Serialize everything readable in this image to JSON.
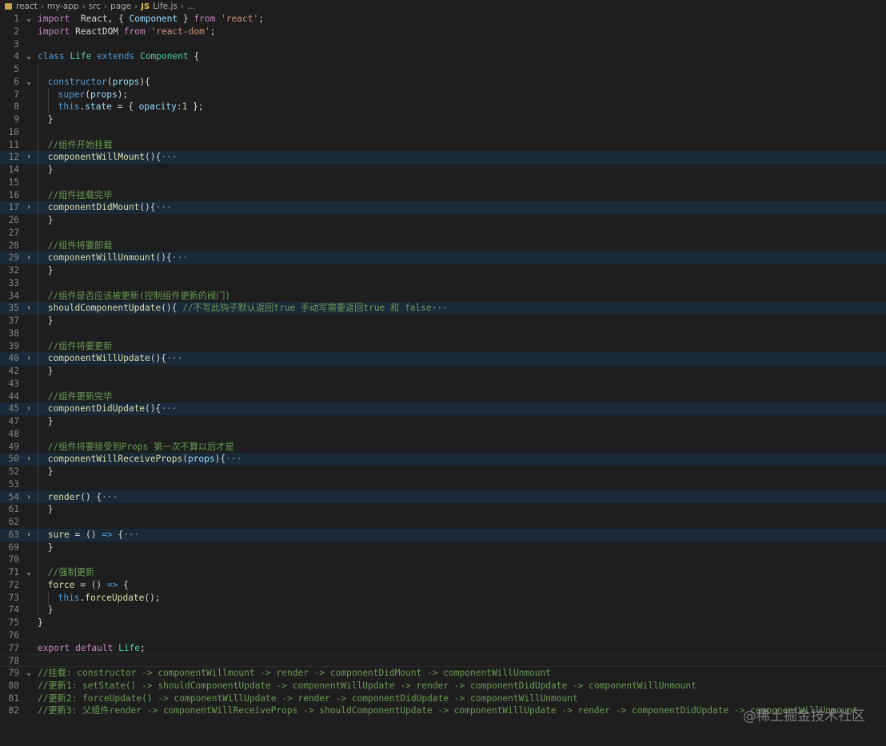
{
  "breadcrumb": {
    "items": [
      "react",
      "my-app",
      "src",
      "page"
    ],
    "file_badge": "JS",
    "file": "Life.js",
    "trailing": "..."
  },
  "watermark": "@稀土掘金技术社区",
  "colors": {
    "background": "#1e1e1e",
    "folded_line_bg": "#1b2a38",
    "keyword": "#569cd6",
    "control": "#c586c0",
    "class": "#4ec9b0",
    "function": "#dcdcaa",
    "string": "#ce9178",
    "variable": "#9cdcfe",
    "number": "#b5cea8",
    "comment": "#6a9955"
  },
  "lines": [
    {
      "n": "1",
      "fold": "v",
      "indent": 0,
      "tokens": [
        [
          "ctl",
          "import"
        ],
        [
          "",
          "  React, { "
        ],
        [
          "var",
          "Component"
        ],
        [
          "",
          " } "
        ],
        [
          "ctl",
          "from"
        ],
        [
          "",
          " "
        ],
        [
          "str",
          "'react'"
        ],
        [
          "",
          ";"
        ]
      ]
    },
    {
      "n": "2",
      "indent": 0,
      "tokens": [
        [
          "ctl",
          "import"
        ],
        [
          "",
          " ReactDOM "
        ],
        [
          "ctl",
          "from"
        ],
        [
          "",
          " "
        ],
        [
          "str",
          "'react-dom'"
        ],
        [
          "",
          ";"
        ]
      ]
    },
    {
      "n": "3",
      "indent": 0,
      "tokens": []
    },
    {
      "n": "4",
      "fold": "v",
      "indent": 0,
      "tokens": [
        [
          "kw",
          "class"
        ],
        [
          "",
          " "
        ],
        [
          "cls",
          "Life"
        ],
        [
          "",
          " "
        ],
        [
          "kw",
          "extends"
        ],
        [
          "",
          " "
        ],
        [
          "cls",
          "Component"
        ],
        [
          "",
          " {"
        ]
      ]
    },
    {
      "n": "5",
      "indent": 1,
      "tokens": []
    },
    {
      "n": "6",
      "fold": "v",
      "indent": 1,
      "tokens": [
        [
          "kw",
          "constructor"
        ],
        [
          "",
          "("
        ],
        [
          "var",
          "props"
        ],
        [
          "",
          "){"
        ]
      ]
    },
    {
      "n": "7",
      "indent": 2,
      "tokens": [
        [
          "kw",
          "super"
        ],
        [
          "",
          "("
        ],
        [
          "var",
          "props"
        ],
        [
          "",
          ");"
        ]
      ]
    },
    {
      "n": "8",
      "indent": 2,
      "tokens": [
        [
          "kw",
          "this"
        ],
        [
          "",
          "."
        ],
        [
          "var",
          "state"
        ],
        [
          "",
          " = { "
        ],
        [
          "var",
          "opacity"
        ],
        [
          "",
          ":"
        ],
        [
          "num",
          "1"
        ],
        [
          "",
          " };"
        ]
      ]
    },
    {
      "n": "9",
      "indent": 1,
      "tokens": [
        [
          "",
          "}"
        ]
      ]
    },
    {
      "n": "10",
      "indent": 1,
      "tokens": []
    },
    {
      "n": "11",
      "indent": 1,
      "tokens": [
        [
          "cmt",
          "//组件开始挂载"
        ]
      ]
    },
    {
      "n": "12",
      "fold": ">",
      "folded": true,
      "indent": 1,
      "tokens": [
        [
          "fn",
          "componentWillMount"
        ],
        [
          "",
          "(){"
        ],
        [
          "ell",
          "···"
        ]
      ]
    },
    {
      "n": "14",
      "indent": 1,
      "tokens": [
        [
          "",
          "}"
        ]
      ]
    },
    {
      "n": "15",
      "indent": 1,
      "tokens": []
    },
    {
      "n": "16",
      "indent": 1,
      "tokens": [
        [
          "cmt",
          "//组件挂载完毕"
        ]
      ]
    },
    {
      "n": "17",
      "fold": ">",
      "folded": true,
      "indent": 1,
      "tokens": [
        [
          "fn",
          "componentDidMount"
        ],
        [
          "",
          "(){"
        ],
        [
          "ell",
          "···"
        ]
      ]
    },
    {
      "n": "26",
      "indent": 1,
      "tokens": [
        [
          "",
          "}"
        ]
      ]
    },
    {
      "n": "27",
      "indent": 1,
      "tokens": []
    },
    {
      "n": "28",
      "indent": 1,
      "tokens": [
        [
          "cmt",
          "//组件将要卸载"
        ]
      ]
    },
    {
      "n": "29",
      "fold": ">",
      "folded": true,
      "indent": 1,
      "tokens": [
        [
          "fn",
          "componentWillUnmount"
        ],
        [
          "",
          "(){"
        ],
        [
          "ell",
          "···"
        ]
      ]
    },
    {
      "n": "32",
      "indent": 1,
      "tokens": [
        [
          "",
          "}"
        ]
      ]
    },
    {
      "n": "33",
      "indent": 1,
      "tokens": []
    },
    {
      "n": "34",
      "indent": 1,
      "tokens": [
        [
          "cmt",
          "//组件是否应该被更新(控制组件更新的阀门)"
        ]
      ]
    },
    {
      "n": "35",
      "fold": ">",
      "folded": true,
      "indent": 1,
      "tokens": [
        [
          "fn",
          "shouldComponentUpdate"
        ],
        [
          "",
          "(){ "
        ],
        [
          "cmt",
          "//不写此钩子默认返回true 手动写需要返回true 和 false"
        ],
        [
          "ell",
          "···"
        ]
      ]
    },
    {
      "n": "37",
      "indent": 1,
      "tokens": [
        [
          "",
          "}"
        ]
      ]
    },
    {
      "n": "38",
      "indent": 1,
      "tokens": []
    },
    {
      "n": "39",
      "indent": 1,
      "tokens": [
        [
          "cmt",
          "//组件将要更新"
        ]
      ]
    },
    {
      "n": "40",
      "fold": ">",
      "folded": true,
      "indent": 1,
      "tokens": [
        [
          "fn",
          "componentWillUpdate"
        ],
        [
          "",
          "(){"
        ],
        [
          "ell",
          "···"
        ]
      ]
    },
    {
      "n": "42",
      "indent": 1,
      "tokens": [
        [
          "",
          "}"
        ]
      ]
    },
    {
      "n": "43",
      "indent": 1,
      "tokens": []
    },
    {
      "n": "44",
      "indent": 1,
      "tokens": [
        [
          "cmt",
          "//组件更新完毕"
        ]
      ]
    },
    {
      "n": "45",
      "fold": ">",
      "folded": true,
      "indent": 1,
      "tokens": [
        [
          "fn",
          "componentDidUpdate"
        ],
        [
          "",
          "(){"
        ],
        [
          "ell",
          "···"
        ]
      ]
    },
    {
      "n": "47",
      "indent": 1,
      "tokens": [
        [
          "",
          "}"
        ]
      ]
    },
    {
      "n": "48",
      "indent": 1,
      "tokens": []
    },
    {
      "n": "49",
      "indent": 1,
      "tokens": [
        [
          "cmt",
          "//组件将要接受到Props 第一次不算以后才是"
        ]
      ]
    },
    {
      "n": "50",
      "fold": ">",
      "folded": true,
      "indent": 1,
      "tokens": [
        [
          "fn",
          "componentWillReceiveProps"
        ],
        [
          "",
          "("
        ],
        [
          "var",
          "props"
        ],
        [
          "",
          "){"
        ],
        [
          "ell",
          "···"
        ]
      ]
    },
    {
      "n": "52",
      "indent": 1,
      "tokens": [
        [
          "",
          "}"
        ]
      ]
    },
    {
      "n": "53",
      "indent": 1,
      "tokens": []
    },
    {
      "n": "54",
      "fold": ">",
      "folded": true,
      "indent": 1,
      "tokens": [
        [
          "fn",
          "render"
        ],
        [
          "",
          "() {"
        ],
        [
          "ell",
          "···"
        ]
      ]
    },
    {
      "n": "61",
      "indent": 1,
      "tokens": [
        [
          "",
          "}"
        ]
      ]
    },
    {
      "n": "62",
      "indent": 1,
      "tokens": []
    },
    {
      "n": "63",
      "fold": ">",
      "folded": true,
      "indent": 1,
      "tokens": [
        [
          "fn",
          "sure"
        ],
        [
          "",
          " = () "
        ],
        [
          "kw",
          "=>"
        ],
        [
          "",
          " {"
        ],
        [
          "ell",
          "···"
        ]
      ]
    },
    {
      "n": "69",
      "indent": 1,
      "tokens": [
        [
          "",
          "}"
        ]
      ]
    },
    {
      "n": "70",
      "indent": 1,
      "tokens": []
    },
    {
      "n": "71",
      "fold": "v",
      "indent": 1,
      "tokens": [
        [
          "cmt",
          "//强制更新"
        ]
      ]
    },
    {
      "n": "72",
      "indent": 1,
      "tokens": [
        [
          "fn",
          "force"
        ],
        [
          "",
          " = () "
        ],
        [
          "kw",
          "=>"
        ],
        [
          "",
          " {"
        ]
      ]
    },
    {
      "n": "73",
      "indent": 2,
      "tokens": [
        [
          "kw",
          "this"
        ],
        [
          "",
          "."
        ],
        [
          "fn",
          "forceUpdate"
        ],
        [
          "",
          "();"
        ]
      ]
    },
    {
      "n": "74",
      "indent": 1,
      "tokens": [
        [
          "",
          "}"
        ]
      ]
    },
    {
      "n": "75",
      "indent": 0,
      "tokens": [
        [
          "",
          "}"
        ]
      ]
    },
    {
      "n": "76",
      "indent": 0,
      "tokens": []
    },
    {
      "n": "77",
      "indent": 0,
      "tokens": [
        [
          "ctl",
          "export"
        ],
        [
          "",
          " "
        ],
        [
          "ctl",
          "default"
        ],
        [
          "",
          " "
        ],
        [
          "cls",
          "Life"
        ],
        [
          "",
          ";"
        ]
      ]
    },
    {
      "n": "78",
      "indent": 0,
      "cursor": true,
      "tokens": []
    },
    {
      "n": "79",
      "fold": "v",
      "indent": 0,
      "tokens": [
        [
          "cmt",
          "//挂载: constructor -> componentWillmount -> render -> componentDidMount -> componentWillUnmount"
        ]
      ]
    },
    {
      "n": "80",
      "indent": 0,
      "tokens": [
        [
          "cmt",
          "//更新1: setState() -> shouldComponentUpdate -> componentWillUpdate -> render -> componentDidUpdate -> componentWillUnmount"
        ]
      ]
    },
    {
      "n": "81",
      "indent": 0,
      "tokens": [
        [
          "cmt",
          "//更新2: forceUpdate() -> componentWillUpdate -> render -> componentDidUpdate -> componentWillUnmount"
        ]
      ]
    },
    {
      "n": "82",
      "indent": 0,
      "tokens": [
        [
          "cmt",
          "//更新3: 父组件render -> componentWillReceiveProps -> shouldComponentUpdate -> componentWillUpdate -> render -> componentDidUpdate -> componentWillUnmount"
        ]
      ]
    }
  ]
}
